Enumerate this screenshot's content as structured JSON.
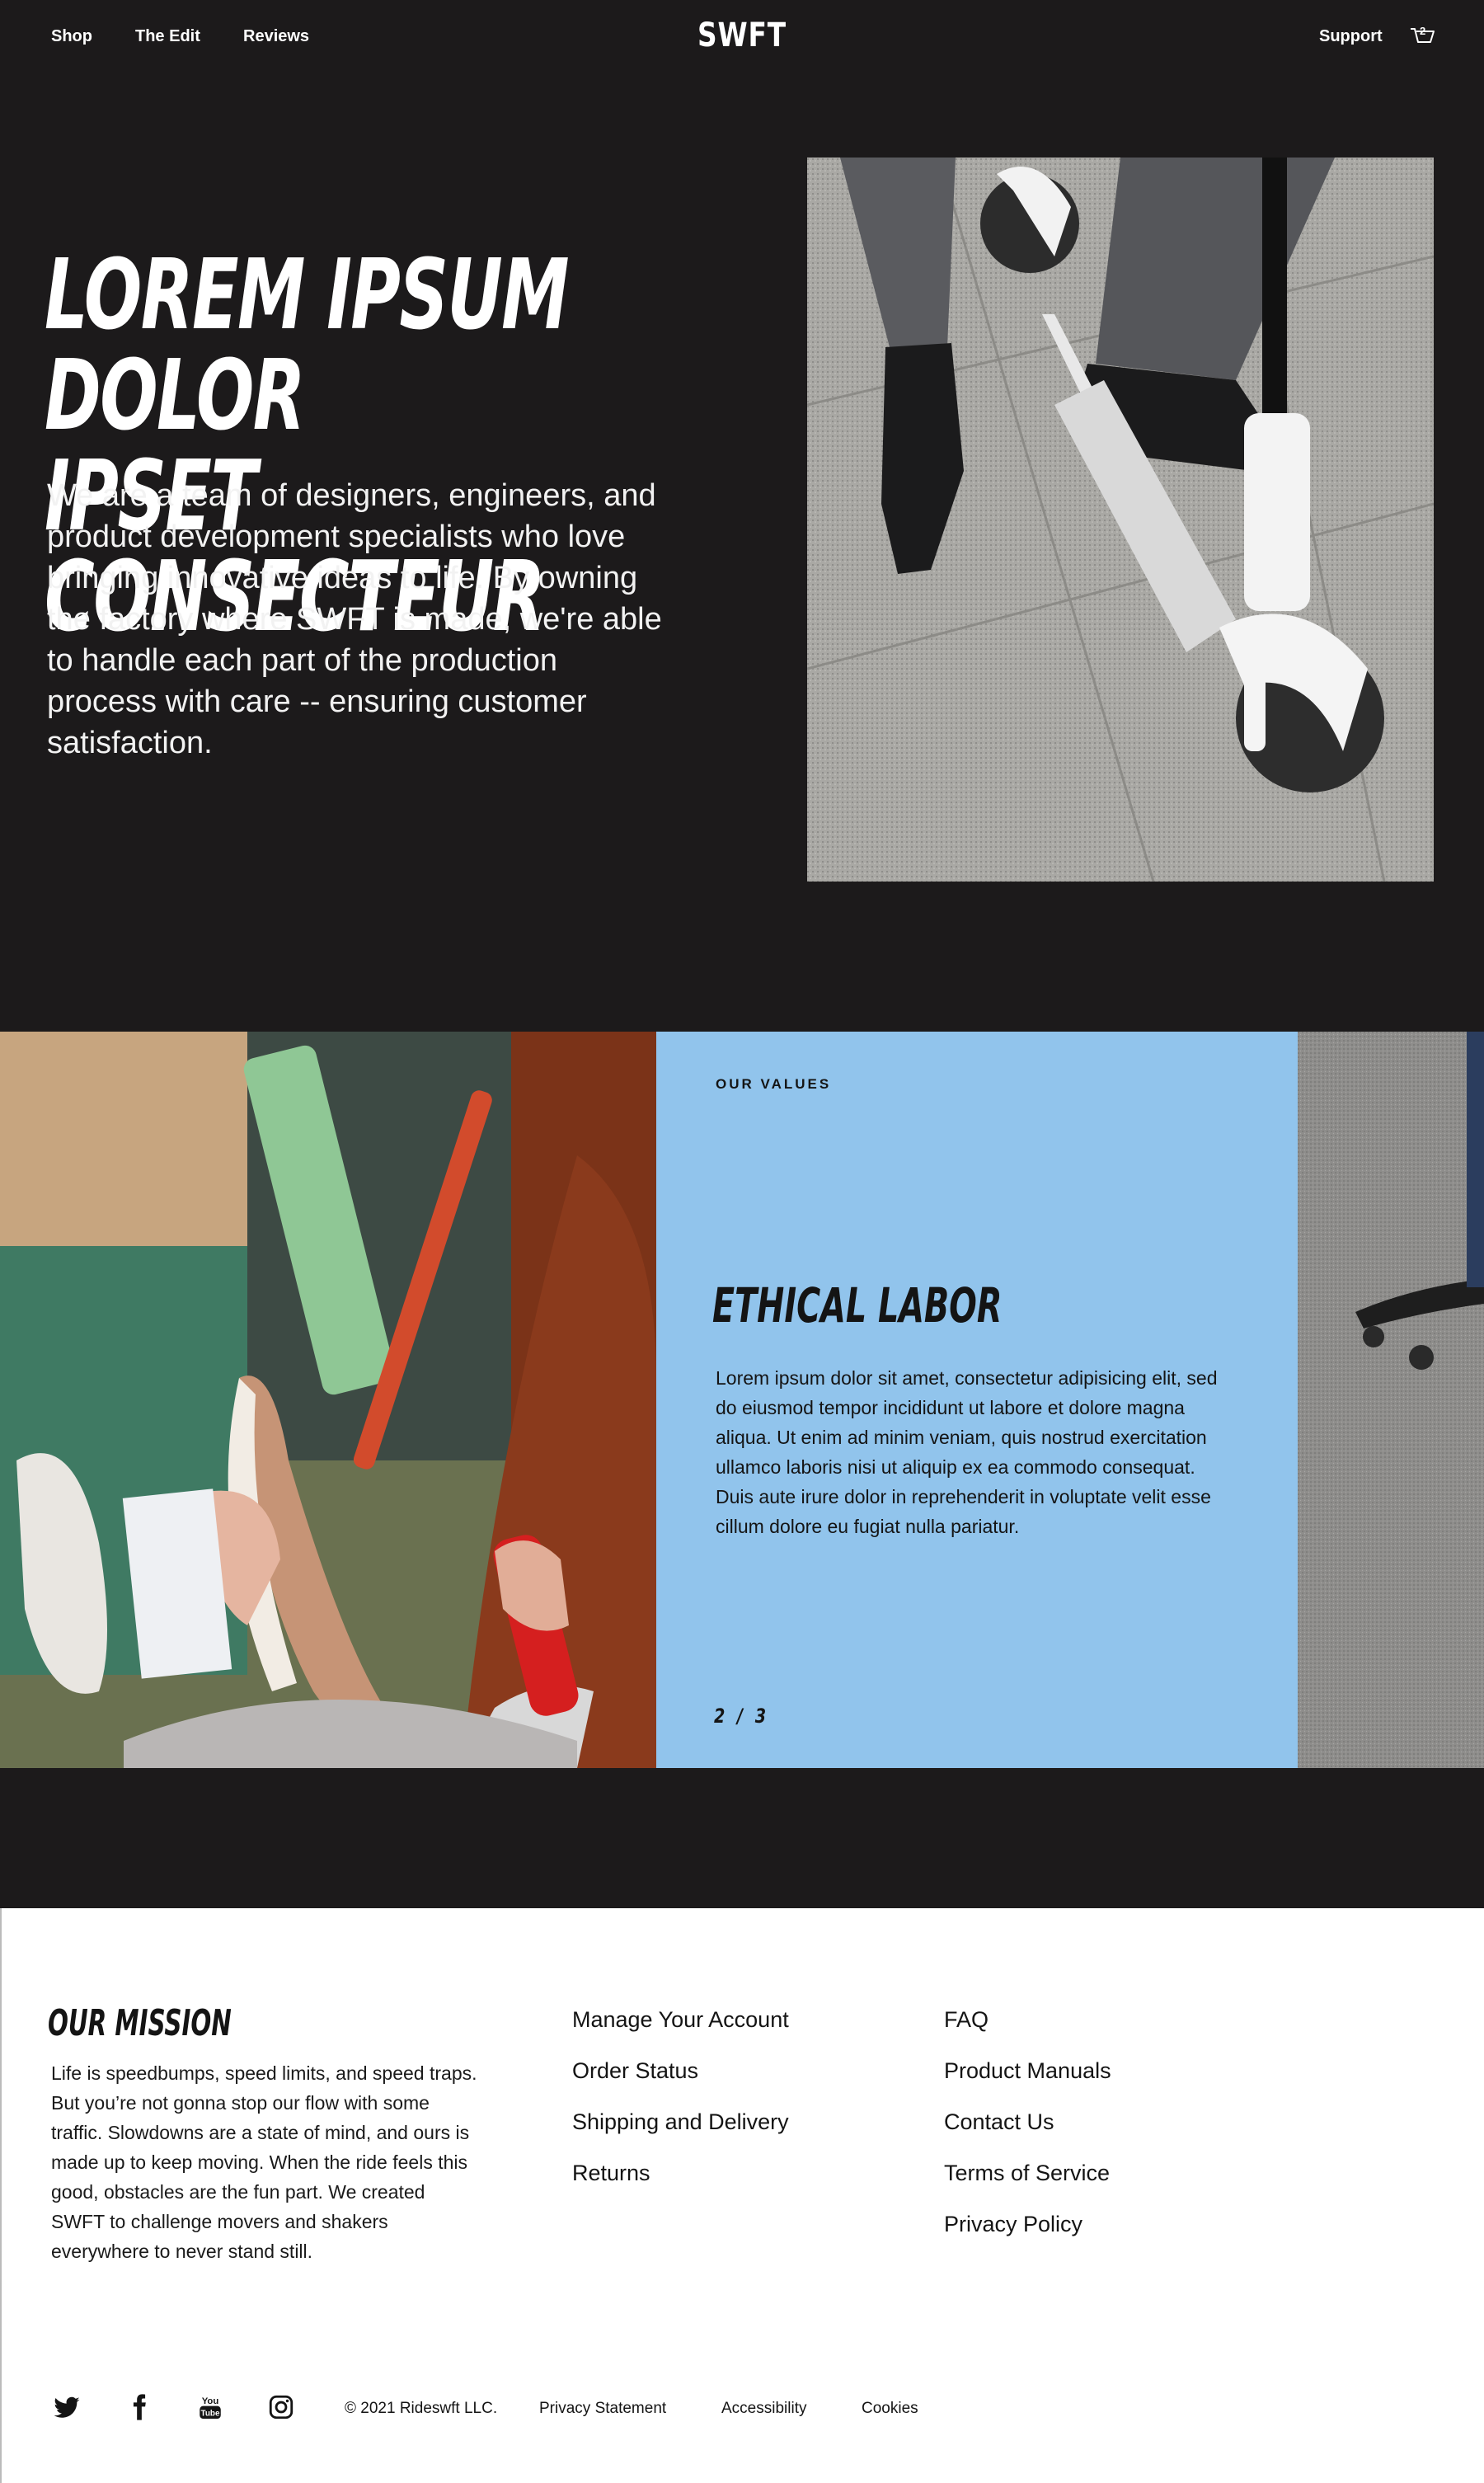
{
  "nav": {
    "left_links": [
      "Shop",
      "The Edit",
      "Reviews"
    ],
    "logo": "SWFT",
    "support": "Support",
    "cart_count": "2"
  },
  "hero": {
    "title_line1": "LOREM IPSUM DOLOR",
    "title_line2": "IPSET CONSECTEUR",
    "body": "We are a team of designers, engineers, and product development specialists who love bringing innovative ideas to life. By owning the factory where SWFT is made, we're able to handle each part of the production process with care -- ensuring customer satisfaction."
  },
  "values": {
    "eyebrow": "OUR VALUES",
    "title": "ETHICAL LABOR",
    "body": "Lorem ipsum dolor sit amet, consectetur adipisicing elit, sed do eiusmod tempor incididunt ut labore et dolore magna aliqua. Ut enim ad minim veniam, quis nostrud exercitation ullamco laboris nisi ut aliquip ex ea commodo consequat. Duis aute irure dolor in reprehenderit in voluptate velit esse cillum dolore eu fugiat nulla pariatur.",
    "pagination": "2 / 3"
  },
  "footer": {
    "mission_title": "OUR MISSION",
    "mission_text": "Life is speedbumps, speed limits, and speed traps. But you’re not gonna stop our flow with some traffic. Slowdowns are a state of mind, and ours is made up to keep moving. When the ride feels this good, obstacles are the fun part. We created SWFT to challenge movers and shakers everywhere to never stand still.",
    "links_col1": [
      "Manage Your Account",
      "Order Status",
      "Shipping and Delivery",
      "Returns"
    ],
    "links_col2": [
      "FAQ",
      "Product Manuals",
      "Contact Us",
      "Terms of Service",
      "Privacy Policy"
    ],
    "social_icons": [
      "twitter-icon",
      "facebook-icon",
      "youtube-icon",
      "instagram-icon"
    ],
    "copyright": "© 2021 Rideswft LLC.",
    "legal_links": [
      "Privacy Statement",
      "Accessibility",
      "Cookies"
    ]
  },
  "colors": {
    "background": "#1c1a1b",
    "values_panel": "#91c4ec",
    "footer_bg": "#ffffff",
    "text_dark": "#141414"
  }
}
